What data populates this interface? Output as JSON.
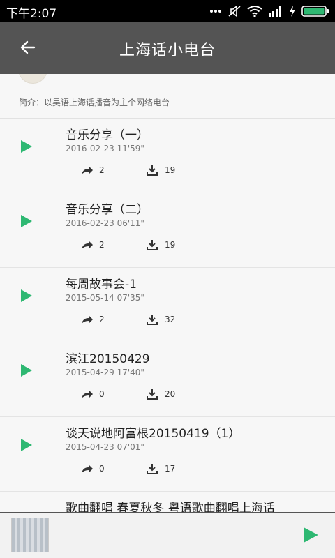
{
  "status": {
    "time": "下午2:07",
    "icons": [
      "more-dots-icon",
      "mute-icon",
      "wifi-icon",
      "signal-icon",
      "charging-icon",
      "battery-icon"
    ]
  },
  "header": {
    "title": "上海话小电台",
    "back_icon": "arrow-left-icon"
  },
  "intro": {
    "text": "简介：以吴语上海话播音为主个网络电台"
  },
  "tracks": [
    {
      "title": "音乐分享（一）",
      "date": "2016-02-23",
      "duration": "11'59\"",
      "shares": "2",
      "downloads": "19"
    },
    {
      "title": "音乐分享（二）",
      "date": "2016-02-23",
      "duration": "06'11\"",
      "shares": "2",
      "downloads": "19"
    },
    {
      "title": "每周故事会-1",
      "date": "2015-05-14",
      "duration": "07'35\"",
      "shares": "2",
      "downloads": "32"
    },
    {
      "title": "滨江20150429",
      "date": "2015-04-29",
      "duration": "17'40\"",
      "shares": "0",
      "downloads": "20"
    },
    {
      "title": "谈天说地阿富根20150419（1）",
      "date": "2015-04-23",
      "duration": "07'01\"",
      "shares": "0",
      "downloads": "17"
    },
    {
      "title": "歌曲翻唱 春夏秋冬 粤语歌曲翻唱上海话",
      "date": "",
      "duration": "",
      "shares": "",
      "downloads": ""
    }
  ],
  "colors": {
    "accent": "#2eb872",
    "app_bar": "#545454",
    "status_bar": "#000000",
    "background": "#f7f7f7"
  }
}
